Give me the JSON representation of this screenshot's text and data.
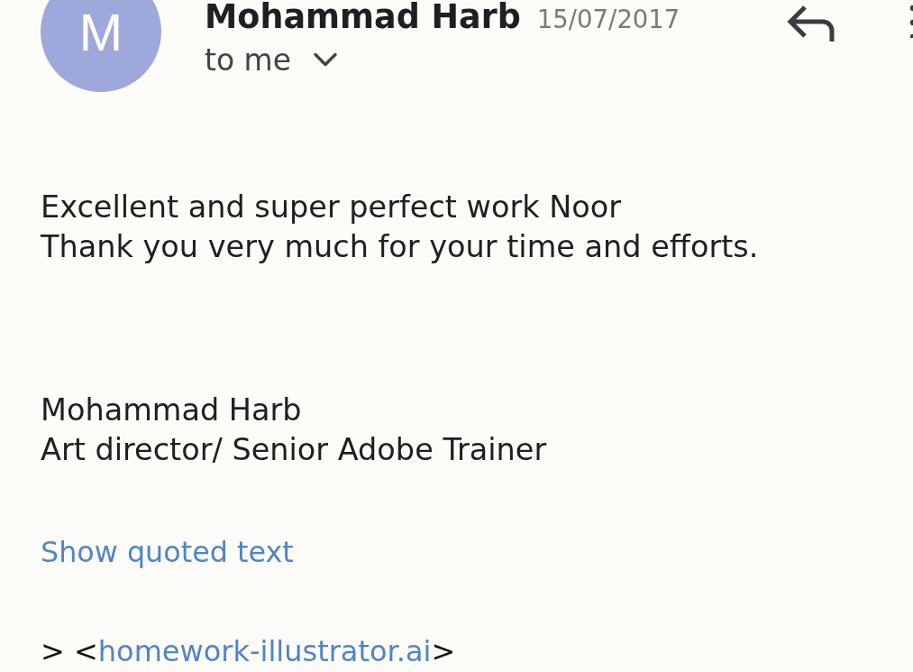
{
  "message": {
    "sender": {
      "avatar_letter": "M",
      "name": "Mohammad Harb",
      "date": "15/07/2017"
    },
    "recipient": "to me",
    "body": [
      {
        "kind": "text",
        "lines": [
          "Excellent and super perfect work Noor",
          "Thank you very much for your time and efforts."
        ]
      },
      {
        "kind": "text",
        "lines": [
          "Mohammad Harb",
          "Art director/ Senior Adobe Trainer"
        ]
      }
    ],
    "show_quoted_text": "Show quoted text",
    "attachment_line": {
      "prefix": "> <",
      "link": "homework-illustrator.ai",
      "suffix": ">"
    }
  }
}
